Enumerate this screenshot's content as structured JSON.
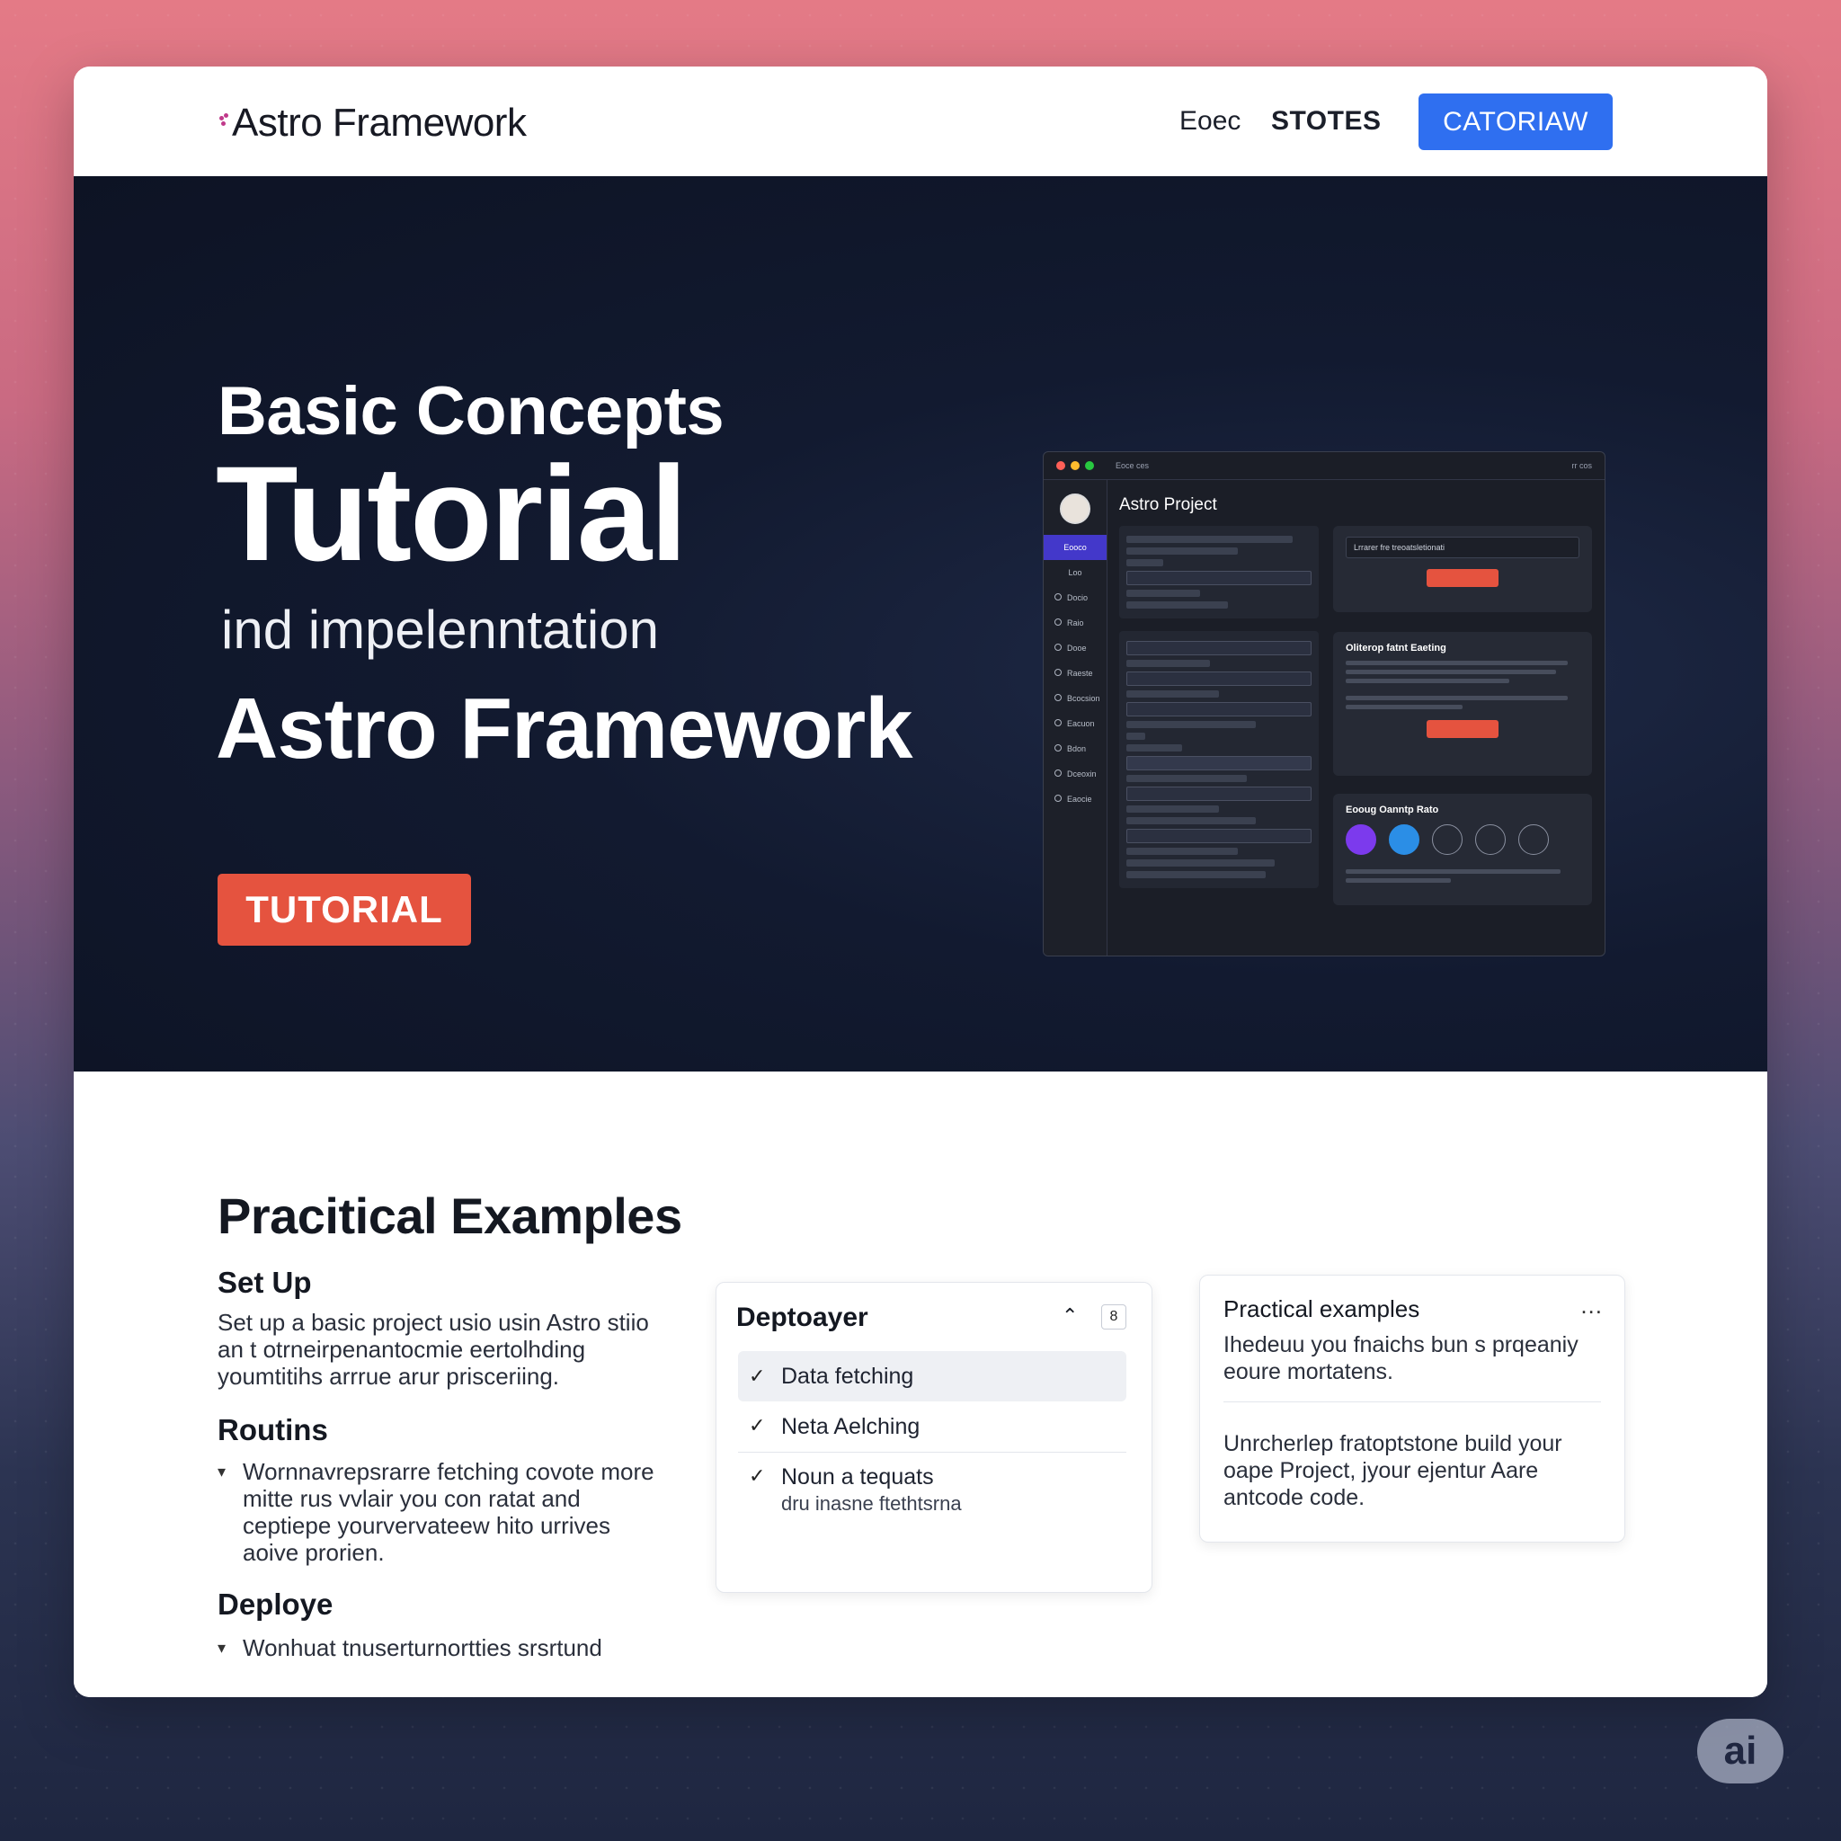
{
  "nav": {
    "logo": "Astro Framework",
    "links": [
      "Eoec",
      "STOTES"
    ],
    "cta": "CATORIAW"
  },
  "hero": {
    "subtitle": "Basic Concepts",
    "title": "Tutorial",
    "line3": "ind impelenntation",
    "line4": "Astro Framework",
    "button": "TUTORIAL"
  },
  "mockup": {
    "window_title": "Eoce ces",
    "window_right": "rr cos",
    "project_title": "Astro Project",
    "sidebar": [
      "Eooco",
      "Loo",
      "Docio",
      "Raio",
      "Dooe",
      "Raeste",
      "Bcocsion",
      "Eacuon",
      "Bdon",
      "Dceoxin",
      "Eaocie"
    ],
    "card1_input": "Lrrarer fre treoatsletionati",
    "card2_title": "Oliterop fatnt Eaeting",
    "card3_title": "Eooug Oanntp Rato"
  },
  "content": {
    "title": "Pracitical Examples",
    "setup_heading": "Set Up",
    "setup_text": "Set up a basic project usio usin Astro stiio an t otrneirpenantocmie eertolhding youmtitihs arrrue arur prisceriing.",
    "routins_heading": "Routins",
    "routins_bullet": "Wornnavrepsrarre fetching covote more mitte rus vvlair you con ratat and ceptiepe yourvervateew hito urrives aoive prorien.",
    "deploye_heading": "Deploye",
    "deploye_bullet": "Wonhuat tnuserturnortties srsrtund"
  },
  "panel": {
    "title": "Deptoayer",
    "badge": "8",
    "items": [
      "Data fetching",
      "Neta Aelching",
      "Noun a tequats"
    ],
    "item3_sub": "dru inasne ftethtsrna"
  },
  "card": {
    "title": "Practical examples",
    "menu": "...",
    "p1": "Ihedeuu you fnaichs bun s prqeaniy eoure mortatens.",
    "p2": "Unrcherlep fratoptstone build your oape Project, jyour ejentur Aare antcode code."
  },
  "badge": "ai"
}
